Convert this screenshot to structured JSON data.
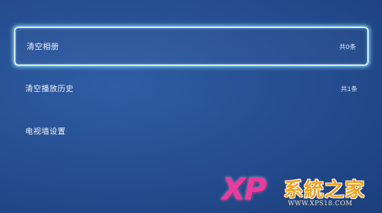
{
  "settings": {
    "items": [
      {
        "label": "清空相册",
        "value": "共0条"
      },
      {
        "label": "清空播放历史",
        "value": "共1条"
      },
      {
        "label": "电视墙设置",
        "value": ""
      }
    ]
  },
  "watermark": {
    "logo": "XP",
    "brand": "系統之家",
    "url": "WWW.XPS18.COM"
  }
}
